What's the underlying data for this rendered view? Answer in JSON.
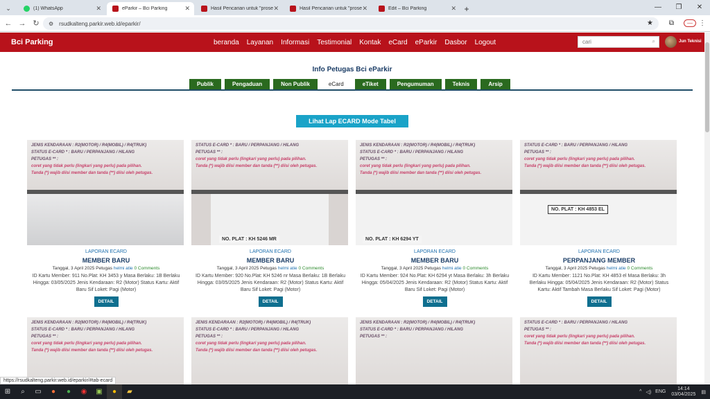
{
  "browser": {
    "tabs": [
      {
        "title": "(1) WhatsApp",
        "color": "#25d366"
      },
      {
        "title": "eParkir – Bci Parking",
        "color": "#b8121b"
      },
      {
        "title": "Hasil Pencarian untuk \"prosedu",
        "color": "#b8121b"
      },
      {
        "title": "Hasil Pencarian untuk \"prosedu",
        "color": "#b8121b"
      },
      {
        "title": "Edit – Bci Parking",
        "color": "#b8121b"
      }
    ],
    "url": "rsudkalteng.parkir.web.id/eparkir/"
  },
  "site": {
    "brand": "Bci Parking",
    "menu": [
      "beranda",
      "Layanan",
      "Informasi",
      "Testimonial",
      "Kontak",
      "eCard",
      "eParkir",
      "Dasbor",
      "Logout"
    ],
    "search_placeholder": "cari",
    "user": "Jun Teknisi"
  },
  "page": {
    "title": "Info Petugas Bci eParkir",
    "tabs": [
      "Publik",
      "Pengaduan",
      "Non Publik",
      "eCard",
      "eTiket",
      "Pengumuman",
      "Teknis",
      "Arsip"
    ],
    "active_tab": "eCard",
    "lap_button": "Lihat Lap ECARD Mode Tabel"
  },
  "photo_text": {
    "line1": "JENIS KENDARAAN : R2(MOTOR) / R4(MOBIL) / R4(TRUK)",
    "line2": "STATUS E-CARD * : BARU / PERPANJANG / HILANG",
    "line3": "PETUGAS ** :",
    "line4": "coret yang tidak perlu (lingkari yang perlu) pada pilihan.",
    "line5": "Tanda (*) wajib diisi member dan tanda (**) diisi oleh petugas."
  },
  "cards": [
    {
      "category": "LAPORAN ECARD",
      "title": "MEMBER BARU",
      "date": "Tanggal, 3 April 2025",
      "petugas_label": "Petugas",
      "author": "helmi atie",
      "comments": "0 Comments",
      "desc": "ID Kartu Member: 911 No.Plat: KH 3453 y Masa Berlaku: 1B Berlaku Hingga: 03/05/2025 Jenis Kendaraan: R2 (Motor) Status Kartu: Aktif Baru Sif Loket: Pagi (Motor)",
      "button": "DETAIL",
      "plate": ""
    },
    {
      "category": "LAPORAN ECARD",
      "title": "MEMBER BARU",
      "date": "Tanggal, 3 April 2025",
      "petugas_label": "Petugas",
      "author": "helmi atie",
      "comments": "0 Comments",
      "desc": "ID Kartu Member: 920 No.Plat: KH 5246 nr Masa Berlaku: 1B Berlaku Hingga: 03/05/2025 Jenis Kendaraan: R2 (Motor) Status Kartu: Aktif Baru Sif Loket: Pagi (Motor)",
      "button": "DETAIL",
      "plate": "NO. PLAT : KH 5246 MR"
    },
    {
      "category": "LAPORAN ECARD",
      "title": "MEMBER BARU",
      "date": "Tanggal, 3 April 2025",
      "petugas_label": "Petugas",
      "author": "helmi atie",
      "comments": "0 Comments",
      "desc": "ID Kartu Member: 924 No.Plat: KH 6294 yt Masa Berlaku: 3h Berlaku Hingga: 05/04/2025 Jenis Kendaraan: R2 (Motor) Status Kartu: Aktif Baru Sif Loket: Pagi (Motor)",
      "button": "DETAIL",
      "plate": "NO. PLAT : KH 6294 YT"
    },
    {
      "category": "LAPORAN ECARD",
      "title": "PERPANJANG MEMBER",
      "date": "Tanggal, 3 April 2025",
      "petugas_label": "Petugas",
      "author": "helmi atie",
      "comments": "0 Comments",
      "desc": "ID Kartu Member: 1121 No.Plat: KH 4853 el Masa Berlaku: 3h Berlaku Hingga: 05/04/2025 Jenis Kendaraan: R2 (Motor) Status Kartu: Aktif Tambah Masa Berlaku Sif Loket: Pagi (Motor)",
      "button": "DETAIL",
      "plate": "NO. PLAT : KH 4853 EL"
    }
  ],
  "status_url": "https://rsudkalteng.parkir.web.id/eparkir/#tab-ecard",
  "taskbar": {
    "lang": "ENG",
    "time": "14:14",
    "date": "03/04/2025"
  }
}
